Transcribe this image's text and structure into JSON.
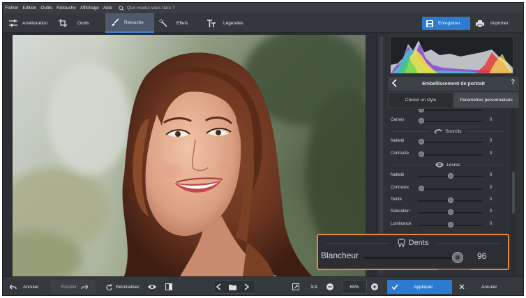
{
  "menu": {
    "items": [
      "Fichier",
      "Edition",
      "Outils",
      "Retouche",
      "Affichage",
      "Aide"
    ],
    "search_placeholder": "Que voulez-vous faire ?"
  },
  "toolbar": {
    "tabs": [
      {
        "label": "Amélioration",
        "icon": "sliders-icon"
      },
      {
        "label": "Outils",
        "icon": "crop-icon"
      },
      {
        "label": "Retouche",
        "icon": "brush-icon",
        "active": true
      },
      {
        "label": "Effets",
        "icon": "magic-wand-icon"
      },
      {
        "label": "Légendes",
        "icon": "text-icon"
      }
    ],
    "save_label": "Enregistrer",
    "print_label": "Imprimer"
  },
  "panel": {
    "title": "Embellissement de portrait",
    "help": "?",
    "tabs": [
      "Choisir un style",
      "Paramètres personnalisés"
    ],
    "rows": [
      {
        "label": "Cernes",
        "value": "0",
        "level": 0
      },
      {
        "label": "Netteté",
        "value": "0",
        "level": 0
      },
      {
        "label": "Contraste",
        "value": "0",
        "level": 0
      },
      {
        "label": "Netteté",
        "value": "0",
        "level": 0.5
      },
      {
        "label": "Contraste",
        "value": "0",
        "level": 0
      },
      {
        "label": "Teinte",
        "value": "0",
        "level": 0.5
      },
      {
        "label": "Saturation",
        "value": "0",
        "level": 0.5
      },
      {
        "label": "Luminance",
        "value": "0",
        "level": 0.5
      }
    ],
    "sections": {
      "eyebrows": "Sourcils",
      "lips": "Lèvres"
    }
  },
  "callout": {
    "section": "Dents",
    "label": "Blancheur",
    "value": "96",
    "level": 0.96
  },
  "bottom": {
    "undo": "Annuler",
    "redo": "Rétablir",
    "reset": "Réinitialiser",
    "ratio": "1:1",
    "zoom": "68%",
    "apply": "Appliquer",
    "cancel": "Annuler"
  },
  "colors": {
    "accent": "#2b7bd1",
    "highlight": "#e9873a"
  }
}
